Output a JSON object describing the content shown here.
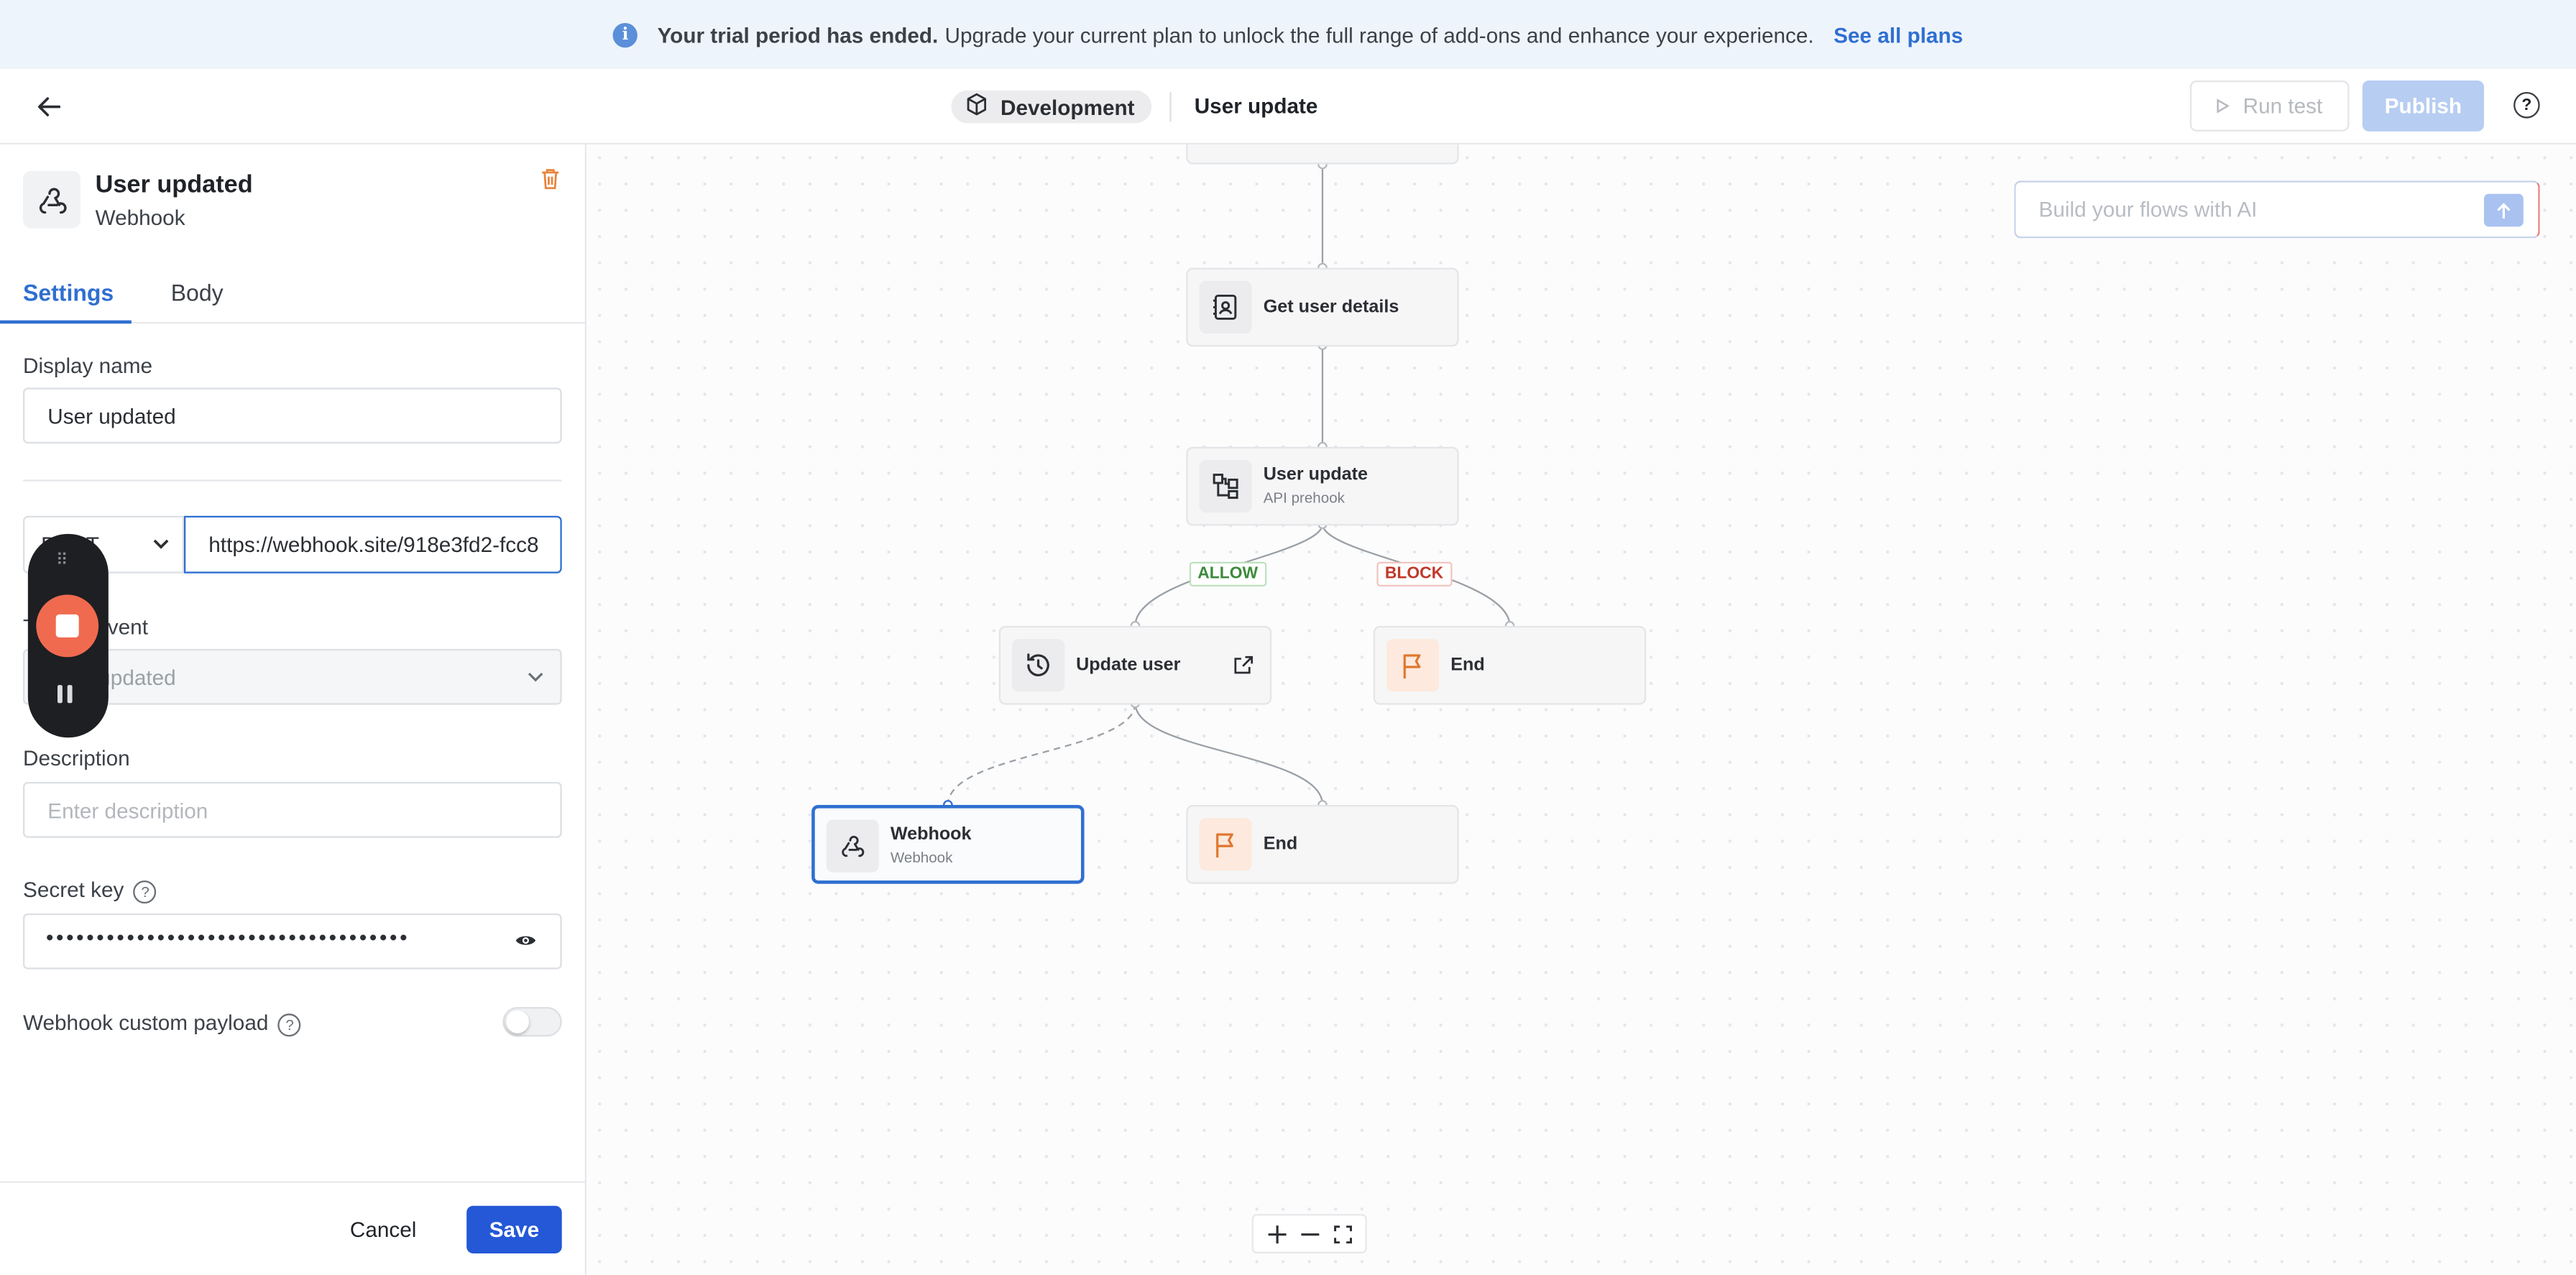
{
  "banner": {
    "bold_text": "Your trial period has ended.",
    "text": "Upgrade your current plan to unlock the full range of add-ons and enhance your experience.",
    "link": "See all plans"
  },
  "header": {
    "environment": "Development",
    "flow_title": "User update",
    "run_test": "Run test",
    "publish": "Publish",
    "help": "?"
  },
  "panel": {
    "title": "User updated",
    "subtitle": "Webhook",
    "tabs": [
      "Settings",
      "Body"
    ],
    "display_name_label": "Display name",
    "display_name_value": "User updated",
    "method_value": "POST",
    "url_value": "https://webhook.site/918e3fd2-fcc8",
    "trigger_event_label": "Trigger event",
    "trigger_event_value": "User updated",
    "description_label": "Description",
    "description_placeholder": "Enter description",
    "secret_key_label": "Secret key",
    "secret_key_value": "••••••••••••••••••••••••••••••••••••",
    "custom_payload_label": "Webhook custom payload",
    "custom_payload_enabled": false,
    "cancel": "Cancel",
    "save": "Save"
  },
  "canvas": {
    "ai_placeholder": "Build your flows with AI",
    "nodes": {
      "get_user_details": "Get user details",
      "user_update_title": "User update",
      "user_update_sub": "API prehook",
      "update_user": "Update user",
      "end_block": "End",
      "webhook_title": "Webhook",
      "webhook_sub": "Webhook",
      "end_allow": "End"
    },
    "branches": {
      "allow": "ALLOW",
      "block": "BLOCK"
    }
  },
  "colors": {
    "accent": "#2f6fd1",
    "save": "#2458d6",
    "allow": "#3c8a3c",
    "block": "#c0392b",
    "recorder_stop": "#f06a4f"
  }
}
